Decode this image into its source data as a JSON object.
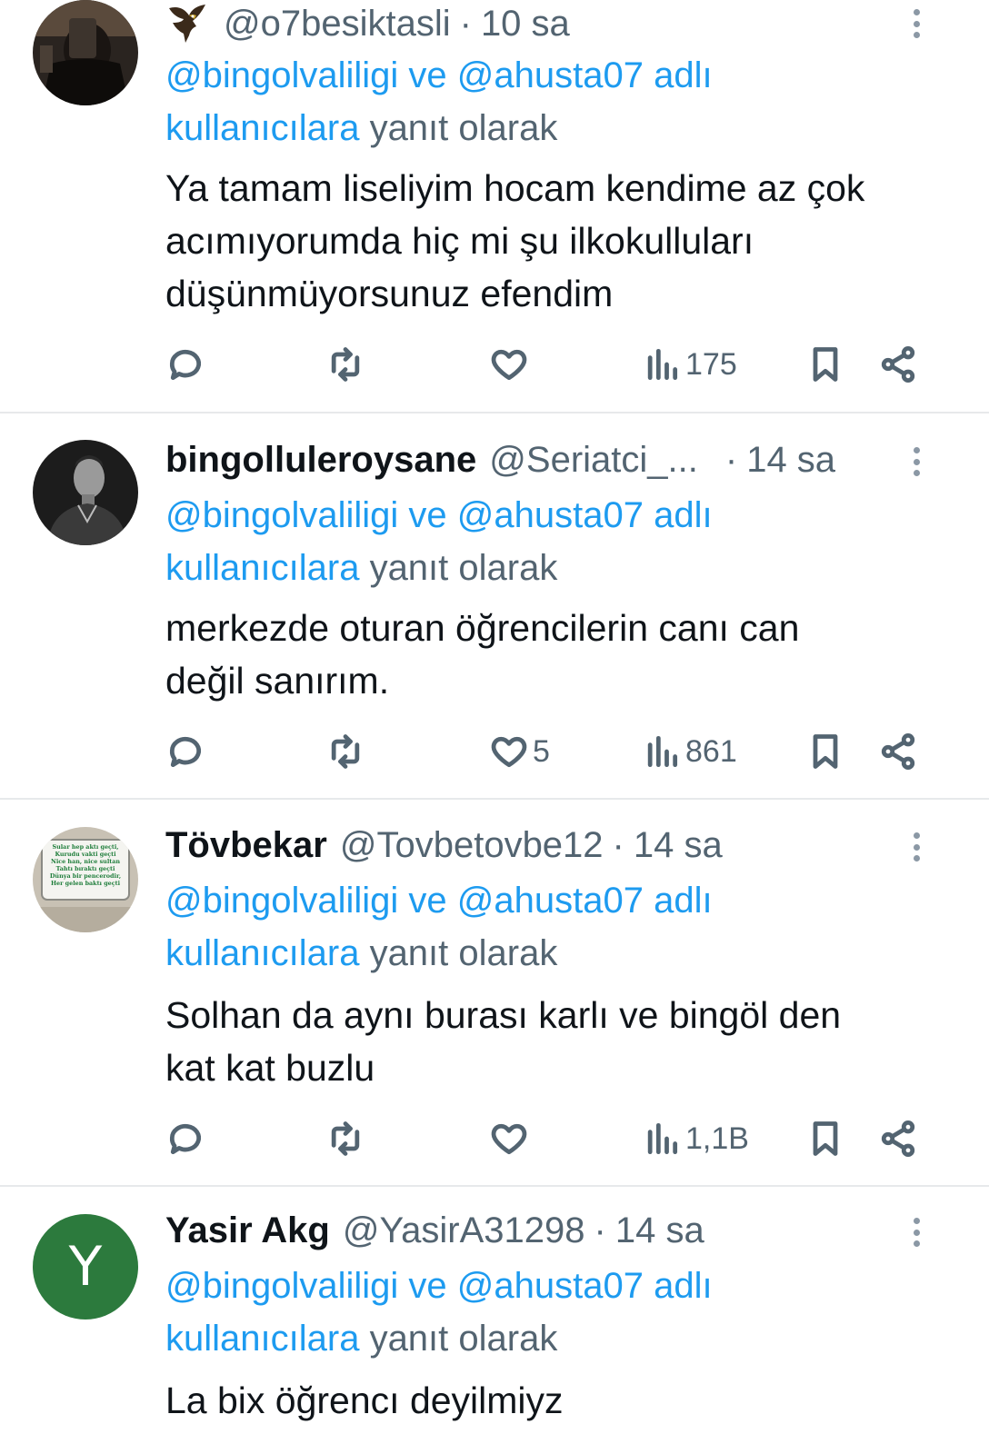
{
  "tweets": [
    {
      "display_name": "",
      "handle": "@o7besiktasli",
      "dot": "·",
      "time": "10 sa",
      "reply": {
        "mention1": "@bingolvaliligi",
        "ve": "ve",
        "mention2": "@ahusta07",
        "adli": "adlı",
        "users": "kullanıcılara",
        "suffix": "yanıt olarak"
      },
      "text": "Ya tamam liseliyim hocam kendime az çok\nacımıyorumda hiç mi şu ilkokulluları\ndüşünmüyorsunuz efendim",
      "likes": "",
      "views": "175"
    },
    {
      "display_name": "bingolluleroysane",
      "handle": "@Seriatci_...",
      "dot": "·",
      "time": "14 sa",
      "reply": {
        "mention1": "@bingolvaliligi",
        "ve": "ve",
        "mention2": "@ahusta07",
        "adli": "adlı",
        "users": "kullanıcılara",
        "suffix": "yanıt olarak"
      },
      "text": "merkezde oturan öğrencilerin canı can\ndeğil sanırım.",
      "likes": "5",
      "views": "861"
    },
    {
      "display_name": "Tövbekar",
      "handle": "@Tovbetovbe12",
      "dot": "·",
      "time": "14 sa",
      "reply": {
        "mention1": "@bingolvaliligi",
        "ve": "ve",
        "mention2": "@ahusta07",
        "adli": "adlı",
        "users": "kullanıcılara",
        "suffix": "yanıt olarak"
      },
      "text": "Solhan da aynı burası karlı ve bingöl den\nkat kat buzlu",
      "likes": "",
      "views": "1,1B",
      "avatar_lines": [
        "Sular hep aktı geçti,",
        "Kurudu vakti geçti",
        "Nice han, nice sultan",
        "Tahtı bıraktı geçti",
        "Dünya bir pencerodir,",
        "Her gelen baktı geçti"
      ]
    },
    {
      "display_name": "Yasir Akg",
      "handle": "@YasirA31298",
      "dot": "·",
      "time": "14 sa",
      "avatar_letter": "Y",
      "reply": {
        "mention1": "@bingolvaliligi",
        "ve": "ve",
        "mention2": "@ahusta07",
        "adli": "adlı",
        "users": "kullanıcılara",
        "suffix": "yanıt olarak"
      },
      "text": "La bix öğrencı deyilmiyz"
    }
  ],
  "colors": {
    "link": "#1d9bf0",
    "secondary": "#536471",
    "text": "#0f1419",
    "divider": "#e7e9eb"
  },
  "icons": [
    "reply-icon",
    "retweet-icon",
    "like-icon",
    "views-icon",
    "bookmark-icon",
    "share-icon",
    "more-icon"
  ]
}
